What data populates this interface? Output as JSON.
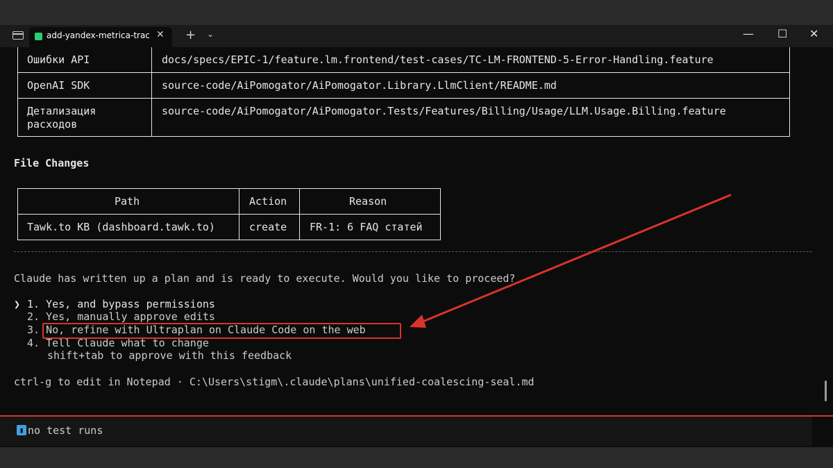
{
  "window": {
    "tab_title": "add-yandex-metrica-track",
    "tab_close": "✕",
    "new_tab": "+",
    "tab_dropdown": "⌄",
    "minimize": "—",
    "maximize": "☐",
    "close": "✕"
  },
  "spec_table": {
    "rows": [
      {
        "label": "Ошибки API",
        "path": "docs/specs/EPIC-1/feature.lm.frontend/test-cases/TC-LM-FRONTEND-5-Error-Handling.feature"
      },
      {
        "label": "OpenAI SDK",
        "path": "source-code/AiPomogator/AiPomogator.Library.LlmClient/README.md"
      },
      {
        "label_line1": "Детализация",
        "label_line2": "расходов",
        "path": "source-code/AiPomogator/AiPomogator.Tests/Features/Billing/Usage/LLM.Usage.Billing.feature"
      }
    ]
  },
  "file_changes": {
    "heading": "File Changes",
    "headers": {
      "path": "Path",
      "action": "Action",
      "reason": "Reason"
    },
    "row": {
      "path": "Tawk.to KB (dashboard.tawk.to)",
      "action": "create",
      "reason": "FR-1: 6 FAQ статей"
    }
  },
  "prompt": {
    "question": "Claude has written up a plan and is ready to execute. Would you like to proceed?",
    "cursor": "❯",
    "options": [
      "1. Yes, and bypass permissions",
      "2. Yes, manually approve edits",
      "3. No, refine with Ultraplan on Claude Code on the web",
      "4. Tell Claude what to change"
    ],
    "option4_hint": "shift+tab to approve with this feedback",
    "footer_hint": "ctrl-g to edit in Notepad · C:\\Users\\stigm\\.claude\\plans\\unified-coalescing-seal.md"
  },
  "status": {
    "badge": "▮",
    "text": "no test runs"
  },
  "colors": {
    "terminal_bg": "#0c0c0c",
    "annotation_red": "#d9342c",
    "tab_green": "#2ecc71",
    "status_blue": "#3fa1e0"
  }
}
